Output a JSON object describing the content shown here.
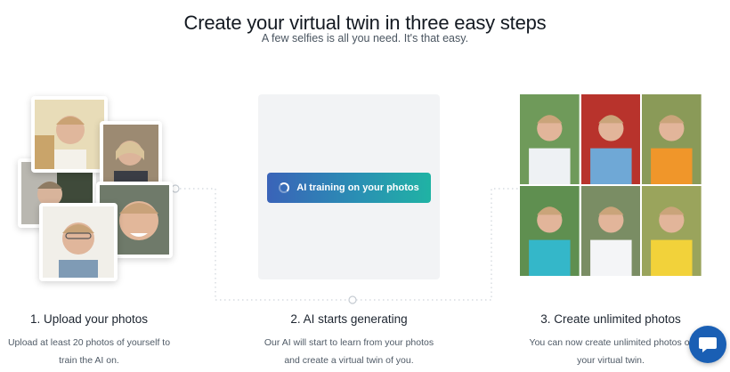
{
  "header": {
    "title": "Create your virtual twin in three easy steps",
    "subtitle": "A few selfies is all you need. It's that easy."
  },
  "steps": [
    {
      "title": "1. Upload your photos",
      "description_line1": "Upload at least 20 photos of yourself to",
      "description_line2": "train the AI on."
    },
    {
      "title": "2. AI starts generating",
      "description_line1": "Our AI will start to learn from your photos",
      "description_line2": "and create a virtual twin of you.",
      "button_label": "AI training on your photos"
    },
    {
      "title": "3. Create unlimited photos",
      "description_line1": "You can now create unlimited photos of",
      "description_line2": "your virtual twin."
    }
  ],
  "colors": {
    "button_gradient_start": "#3a63b8",
    "button_gradient_end": "#20b3a4",
    "chat_button": "#1a5fb4",
    "panel_background": "#f2f3f5"
  },
  "icons": {
    "loading": "loading-spinner-icon",
    "chat": "chat-bubble-icon"
  }
}
